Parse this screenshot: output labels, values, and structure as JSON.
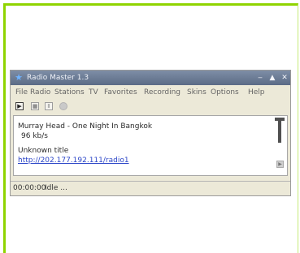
{
  "window": {
    "title": "Radio Master 1.3",
    "controls": {
      "minimize": "‒",
      "maximize": "▲",
      "close": "✕"
    }
  },
  "menu": [
    "File",
    "Radio",
    "Stations",
    "TV",
    "Favorites",
    "Recording",
    "Skins",
    "Options",
    "Help"
  ],
  "toolbar": {
    "play_icon": "▶",
    "stop_icon": "■",
    "pause_icon": "Ⅱ"
  },
  "now_playing": {
    "track": "Murray Head - One Night In Bangkok",
    "bitrate": "96 kb/s",
    "title_label": "Unknown title",
    "stream_url": "http://202.177.192.111/radio1"
  },
  "side_button_icon": "▶",
  "status": {
    "time": "00:00:00",
    "text": "Idle ..."
  },
  "colors": {
    "frame_accent": "#8fd400",
    "titlebar": "#6b7b96",
    "link": "#2c46c8"
  }
}
